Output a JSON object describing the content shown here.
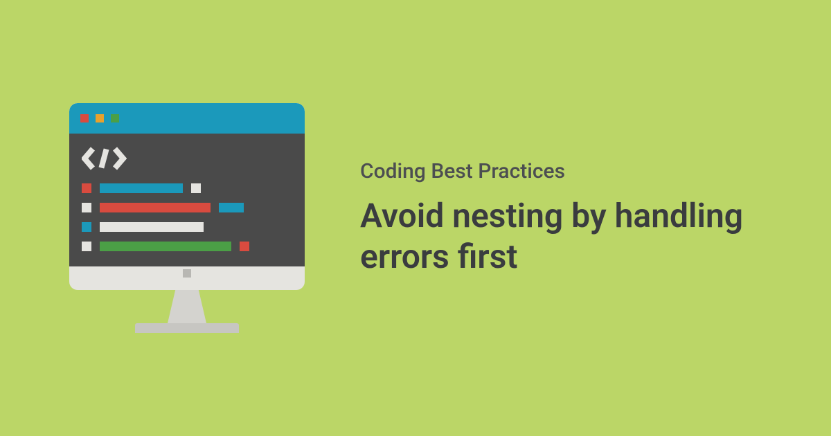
{
  "kicker": "Coding Best Practices",
  "headline": "Avoid nesting by handling errors first",
  "colors": {
    "background": "#bbd667",
    "titlebar": "#1b99bb",
    "editor": "#4a4a4a",
    "red": "#d94b3f",
    "yellow": "#e8a12d",
    "green": "#4b9f46",
    "white": "#e5e4e0",
    "blue": "#1b99bb"
  }
}
